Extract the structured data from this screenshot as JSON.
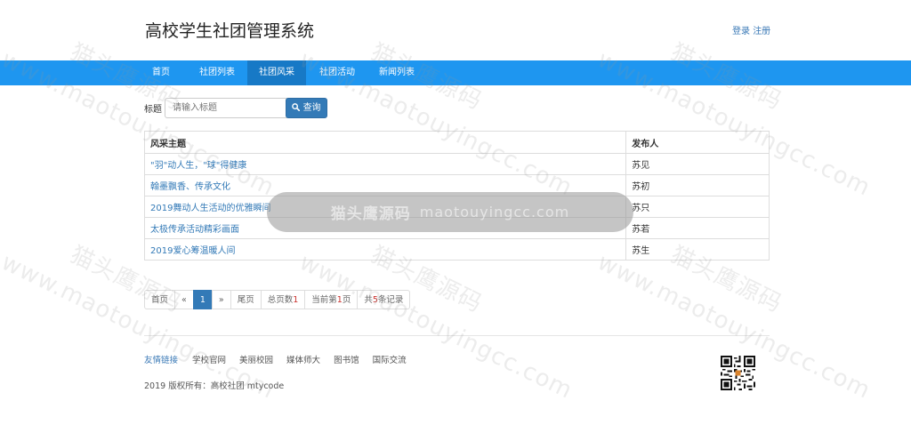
{
  "header": {
    "site_title": "高校学生社团管理系统",
    "login": "登录",
    "register": "注册"
  },
  "nav": {
    "items": [
      {
        "label": "首页",
        "active": false
      },
      {
        "label": "社团列表",
        "active": false
      },
      {
        "label": "社团风采",
        "active": true
      },
      {
        "label": "社团活动",
        "active": false
      },
      {
        "label": "新闻列表",
        "active": false
      }
    ]
  },
  "search": {
    "label": "标题",
    "placeholder": "请输入标题",
    "button": "查询",
    "icon": "search-icon"
  },
  "table": {
    "columns": [
      "风采主题",
      "发布人"
    ],
    "rows": [
      {
        "title": "\"羽\"动人生，\"球\"得健康",
        "publisher": "苏见"
      },
      {
        "title": "翰墨飘香、传承文化",
        "publisher": "苏初"
      },
      {
        "title": "2019舞动人生活动的优雅瞬间",
        "publisher": "苏只"
      },
      {
        "title": "太极传承活动精彩画面",
        "publisher": "苏若"
      },
      {
        "title": "2019爱心筹温暖人间",
        "publisher": "苏生"
      }
    ]
  },
  "pagination": {
    "first": "首页",
    "prev": "«",
    "current": "1",
    "next": "»",
    "last": "尾页",
    "total_pages_label": "总页数",
    "total_pages": "1",
    "current_page_prefix": "当前第",
    "current_page": "1",
    "current_page_suffix": "页",
    "total_records_prefix": "共",
    "total_records": "5",
    "total_records_suffix": "条记录"
  },
  "footer": {
    "links_label": "友情链接",
    "links": [
      "学校官网",
      "美丽校园",
      "媒体师大",
      "图书馆",
      "国际交流"
    ],
    "copyright": "2019 版权所有：高校社团 mtycode"
  },
  "watermark": {
    "cn": "猫头鹰源码",
    "url": "www.maotouyingcc.com",
    "banner_cn": "猫头鹰源码",
    "banner_en": "maotouyingcc.com"
  },
  "colors": {
    "nav_bg": "#1e96f0",
    "nav_active": "#1779c6",
    "link": "#337ab7",
    "primary_btn": "#337ab7"
  }
}
